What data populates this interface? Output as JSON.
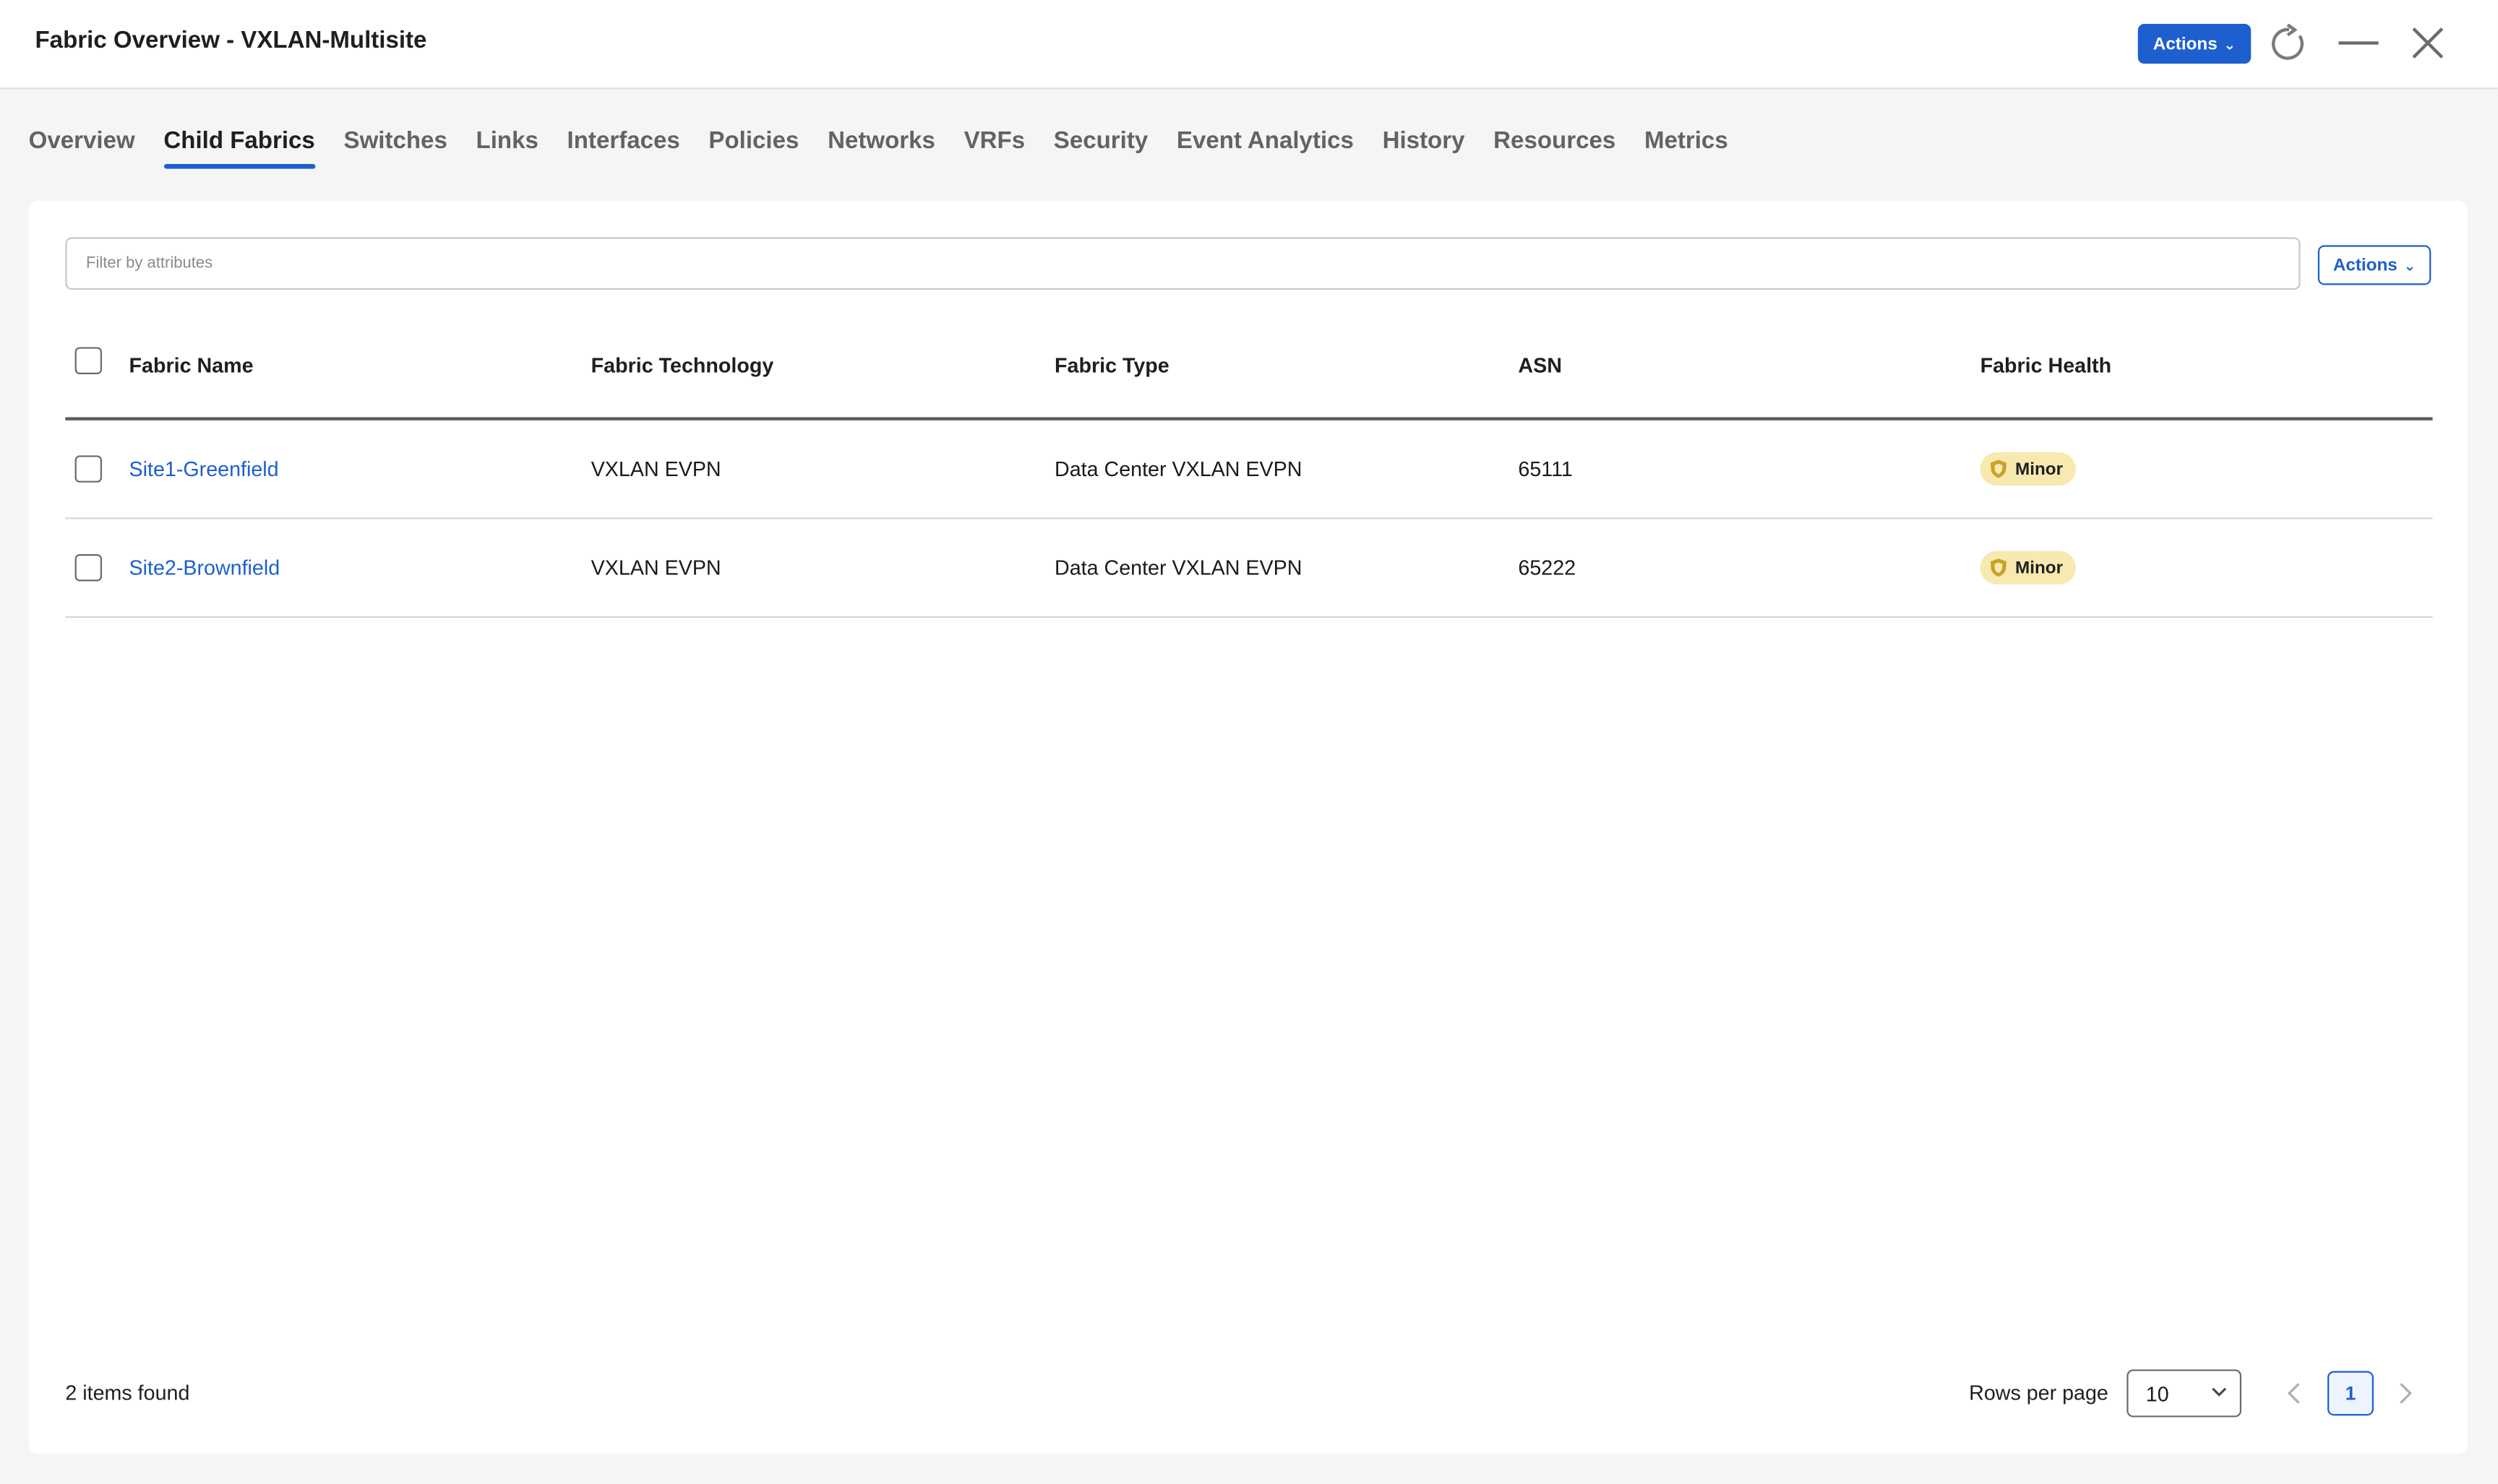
{
  "header": {
    "title": "Fabric Overview - VXLAN-Multisite",
    "actions_label": "Actions"
  },
  "tabs": [
    {
      "label": "Overview",
      "active": false
    },
    {
      "label": "Child Fabrics",
      "active": true
    },
    {
      "label": "Switches",
      "active": false
    },
    {
      "label": "Links",
      "active": false
    },
    {
      "label": "Interfaces",
      "active": false
    },
    {
      "label": "Policies",
      "active": false
    },
    {
      "label": "Networks",
      "active": false
    },
    {
      "label": "VRFs",
      "active": false
    },
    {
      "label": "Security",
      "active": false
    },
    {
      "label": "Event Analytics",
      "active": false
    },
    {
      "label": "History",
      "active": false
    },
    {
      "label": "Resources",
      "active": false
    },
    {
      "label": "Metrics",
      "active": false
    }
  ],
  "filter": {
    "placeholder": "Filter by attributes",
    "actions_label": "Actions"
  },
  "table": {
    "columns": [
      "Fabric Name",
      "Fabric Technology",
      "Fabric Type",
      "ASN",
      "Fabric Health"
    ],
    "rows": [
      {
        "name": "Site1-Greenfield",
        "technology": "VXLAN EVPN",
        "type": "Data Center VXLAN EVPN",
        "asn": "65111",
        "health": "Minor"
      },
      {
        "name": "Site2-Brownfield",
        "technology": "VXLAN EVPN",
        "type": "Data Center VXLAN EVPN",
        "asn": "65222",
        "health": "Minor"
      }
    ]
  },
  "footer": {
    "items_found": "2 items found",
    "rows_per_page_label": "Rows per page",
    "rows_per_page_value": "10",
    "current_page": "1"
  },
  "colors": {
    "accent": "#1d5fcf",
    "badge_minor_bg": "#f7e9b0",
    "badge_minor_icon": "#c9a227"
  }
}
